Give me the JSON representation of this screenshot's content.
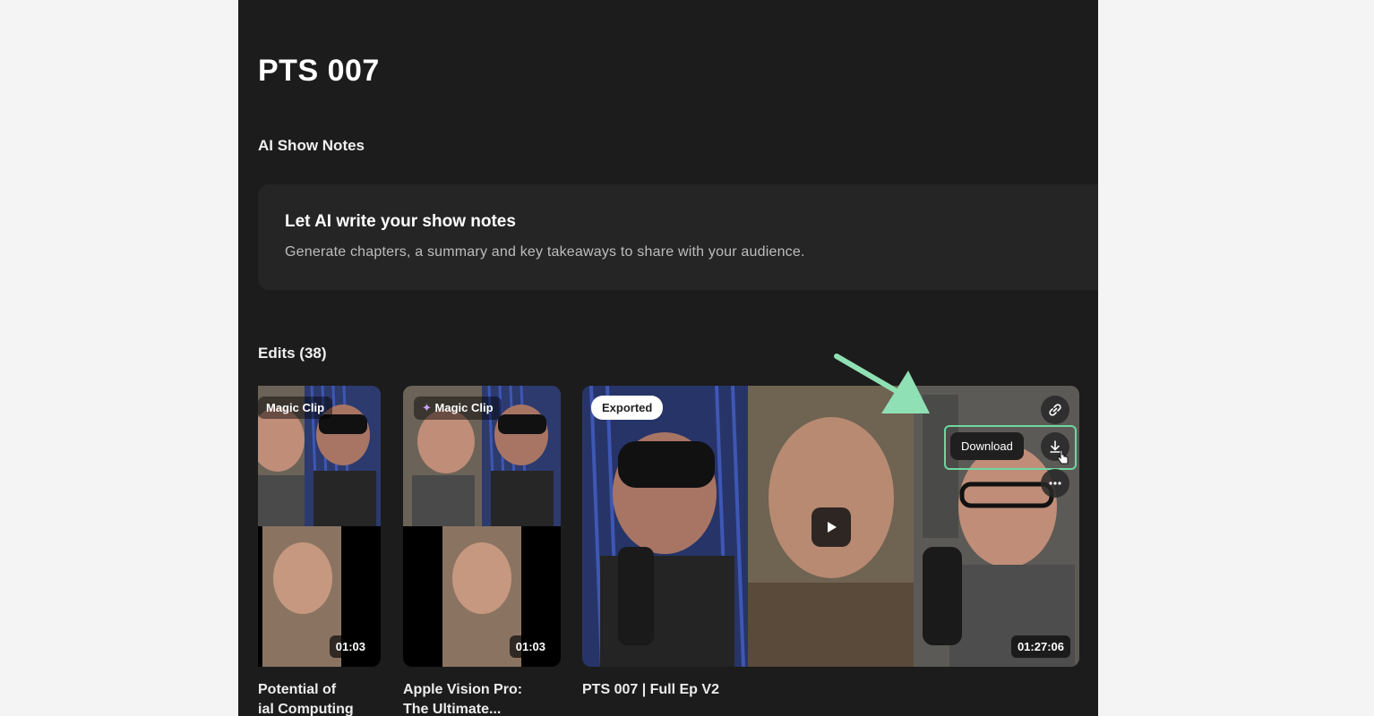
{
  "page": {
    "title": "PTS 007"
  },
  "show_notes": {
    "section_title": "AI Show Notes",
    "card_heading": "Let AI write your show notes",
    "card_description": "Generate chapters, a summary and key takeaways to share with your audience."
  },
  "edits": {
    "section_title": "Edits (38)",
    "items": [
      {
        "badge": "Magic Clip",
        "duration": "01:03",
        "title_line1": "Potential of",
        "title_line2": "ial Computing"
      },
      {
        "badge": "Magic Clip",
        "duration": "01:03",
        "title_line1": "Apple Vision Pro:",
        "title_line2": "The Ultimate..."
      },
      {
        "badge": "Exported",
        "duration": "01:27:06",
        "title_line1": "PTS 007 | Full Ep V2"
      }
    ]
  },
  "actions": {
    "download_tooltip": "Download"
  },
  "icons": [
    "link-icon",
    "download-icon",
    "more-icon",
    "play-icon",
    "sparkle-icon",
    "pointer-cursor-icon"
  ],
  "colors": {
    "background": "#1c1c1c",
    "highlight": "#6fd6a0",
    "accent_arrow": "#8fe0b4"
  }
}
